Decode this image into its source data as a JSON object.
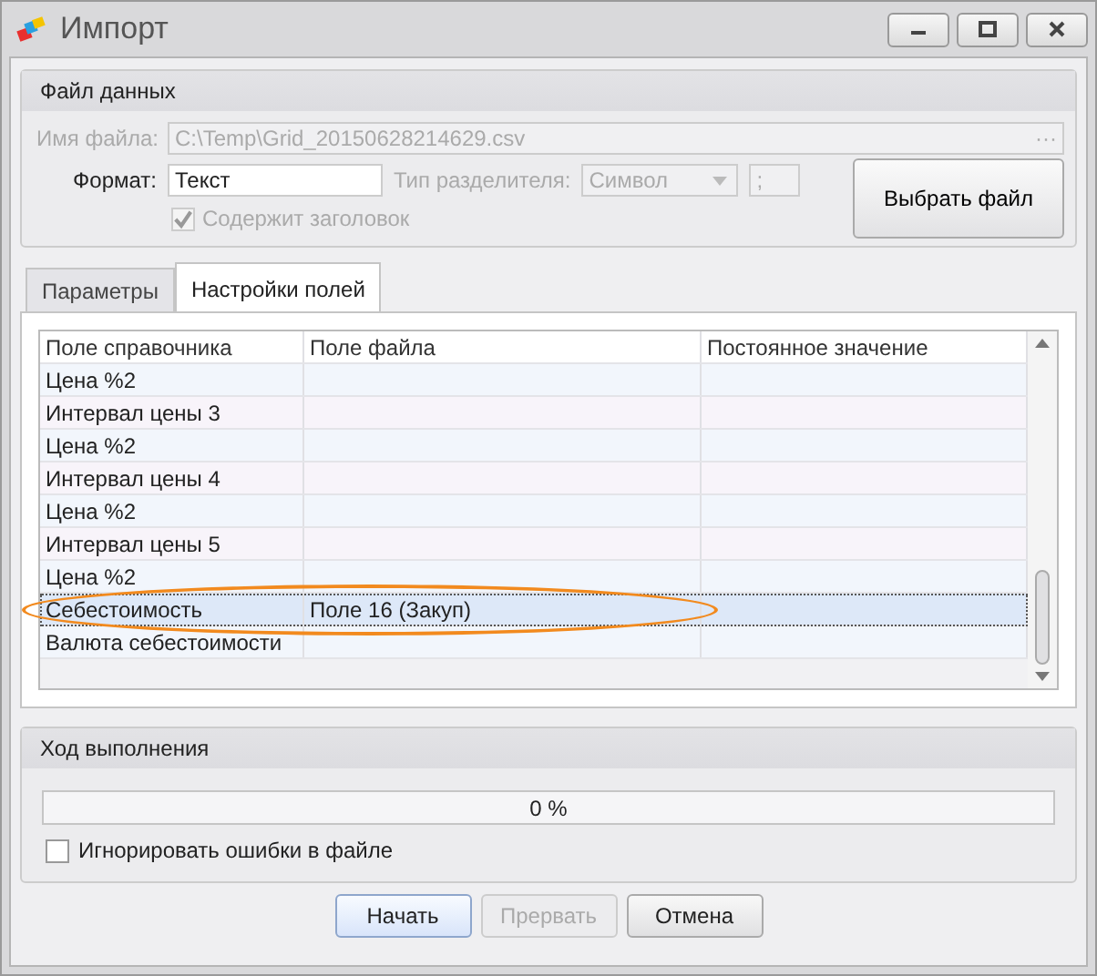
{
  "window": {
    "title": "Импорт"
  },
  "data_file": {
    "title": "Файл данных",
    "filename_label": "Имя файла:",
    "filename": "C:\\Temp\\Grid_20150628214629.csv",
    "filename_disabled": true,
    "browse_glyph": "···",
    "format_label": "Формат:",
    "format": "Текст",
    "separator_label": "Тип разделителя:",
    "separator_type": "Символ",
    "separator": ";",
    "has_header_label": "Содержит заголовок",
    "has_header": {
      "checked": true,
      "disabled": true
    },
    "choose_button": "Выбрать файл"
  },
  "tabs": [
    {
      "label": "Параметры",
      "selected": false
    },
    {
      "label": "Настройки полей",
      "selected": true
    }
  ],
  "table": {
    "columns": [
      "Поле справочника",
      "Поле файла",
      "Постоянное значение"
    ],
    "rows": [
      {
        "cells": [
          "Цена %2",
          "",
          ""
        ],
        "selected": false
      },
      {
        "cells": [
          "Интервал цены 3",
          "",
          ""
        ],
        "selected": false
      },
      {
        "cells": [
          "Цена %2",
          "",
          ""
        ],
        "selected": false
      },
      {
        "cells": [
          "Интервал цены 4",
          "",
          ""
        ],
        "selected": false
      },
      {
        "cells": [
          "Цена %2",
          "",
          ""
        ],
        "selected": false
      },
      {
        "cells": [
          "Интервал цены 5",
          "",
          ""
        ],
        "selected": false
      },
      {
        "cells": [
          "Цена %2",
          "",
          ""
        ],
        "selected": false
      },
      {
        "cells": [
          "Себестоимость",
          "Поле 16 (Закуп)",
          ""
        ],
        "selected": true
      },
      {
        "cells": [
          "Валюта себестоимости",
          "",
          ""
        ],
        "selected": false
      }
    ],
    "highlight": true
  },
  "progress": {
    "title": "Ход выполнения",
    "level": 0,
    "reading": "0 %",
    "ignore_errors_label": "Игнорировать ошибки в файле",
    "ignore_errors": false
  },
  "buttons": [
    {
      "label": "Начать",
      "default": true,
      "disabled": false
    },
    {
      "label": "Прервать",
      "default": false,
      "disabled": true
    },
    {
      "label": "Отмена",
      "default": false,
      "disabled": false
    }
  ]
}
